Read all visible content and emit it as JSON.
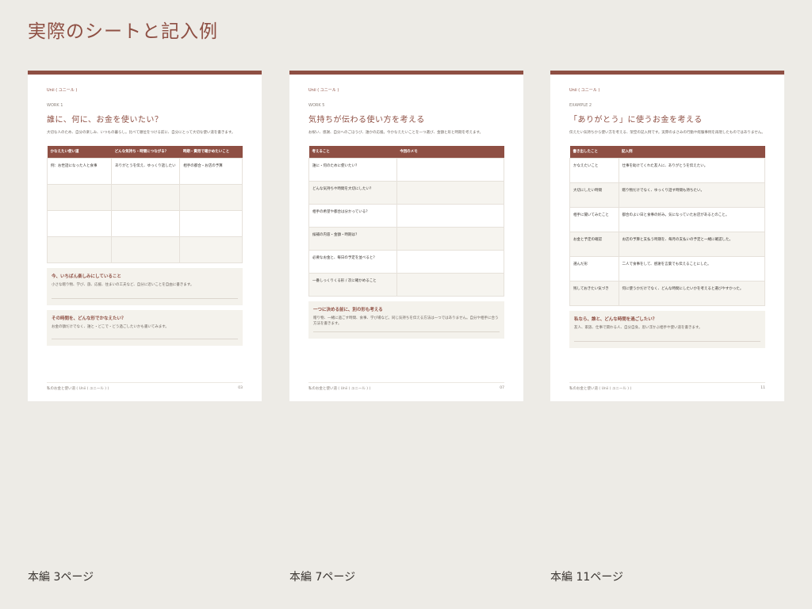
{
  "heading": "実際のシートと記入例",
  "sheets": [
    {
      "logo": "Unii ( ユニール )",
      "kicker": "WORK 1",
      "title": "誰に、何に、お金を使いたい？",
      "desc": "大切な人のため、自分の楽しみ、いつもの暮らし。比べて順位をつける前に、自分にとって大切な使い道を書きます。",
      "headers": [
        "かなえたい使い道",
        "どんな気持ち・時間につながる？",
        "時期・費用で確かめたいこと"
      ],
      "rows": [
        [
          "例：お世話になった人と食事",
          "ありがとうを伝え、ゆっくり話したい",
          "相手の都合・お店の予算"
        ],
        [
          "",
          "",
          ""
        ],
        [
          "",
          "",
          ""
        ],
        [
          "",
          "",
          ""
        ]
      ],
      "notes": [
        {
          "title": "今、いちばん楽しみにしていること",
          "text": "小さな贈り物、学び、旅、応援、住まいの工夫など、自分に近いことを自由に書きます。"
        },
        {
          "title": "その時間を、どんな形でかなえたい？",
          "text": "お金の額だけでなく、誰と・どこで・どう過ごしたいかも書いてみます。"
        }
      ],
      "footer_left": "私のお金と使い道 ( Unii ( ユニール ) )",
      "footer_right": "03",
      "caption": "本編 3ページ"
    },
    {
      "logo": "Unii ( ユニール )",
      "kicker": "WORK 5",
      "title": "気持ちが伝わる使い方を考える",
      "desc": "お祝い、感謝、自分へのごほうび、誰かの応援。今かなえたいことを一つ選び、金額と形と時期を考えます。",
      "headers": [
        "考えること",
        "今回のメモ"
      ],
      "rows": [
        [
          "誰に・何のために使いたい？",
          ""
        ],
        [
          "どんな気持ちや時間を大切にしたい？",
          ""
        ],
        [
          "相手の希望や都合は分かっている？",
          ""
        ],
        [
          "候補の内容・金額・時期は？",
          ""
        ],
        [
          "必要なお金と、毎日の予定を並べると？",
          ""
        ],
        [
          "一番しっくりくる形 / 次に確かめること",
          ""
        ]
      ],
      "notes": [
        {
          "title": "一つに決める前に、別の形も考える",
          "text": "贈り物、一緒に過ごす時間、食事、学び場など。同じ気持ちを伝える方法は一つではありません。自分や相手に合う方法を書きます。"
        }
      ],
      "footer_left": "私のお金と使い道 ( Unii ( ユニール ) )",
      "footer_right": "07",
      "caption": "本編 7ページ"
    },
    {
      "logo": "Unii ( ユニール )",
      "kicker": "EXAMPLE 2",
      "title": "「ありがとう」に使うお金を考える",
      "desc": "伝えたい気持ちから使い方を考える、架空の記入例です。実際のまさみの行動や経験事例を再現したものではありません。",
      "headers": [
        "書き出したこと",
        "記入例"
      ],
      "rows": [
        [
          "かなえたいこと",
          "仕事を助けてくれた友人に、ありがとうを伝えたい。"
        ],
        [
          "大切にしたい時間",
          "贈り物だけでなく、ゆっくり話す時間も持ちたい。"
        ],
        [
          "相手に聞いてみたこと",
          "都合のよい日と食事の好み。気になっていたお店があるとのこと。"
        ],
        [
          "お金と予定の確認",
          "お店の予算と支払う時期を、毎月の支払いの予定と一緒に確認した。"
        ],
        [
          "選んだ形",
          "二人で食事をして、感謝を言葉でも伝えることにした。"
        ],
        [
          "残しておきたい気づき",
          "何に使うかだけでなく、どんな時間にしたいかを考えると選びやすかった。"
        ]
      ],
      "notes": [
        {
          "title": "私なら、誰と、どんな時間を過ごしたい？",
          "text": "友人、家族、仕事で関わる人、自分自身。思い浮かぶ相手や使い道を書きます。"
        }
      ],
      "footer_left": "私のお金と使い道 ( Unii ( ユニール ) )",
      "footer_right": "11",
      "caption": "本編 11ページ"
    }
  ],
  "colors": {
    "accent": "#8e4f43",
    "background": "#edebe6",
    "note_bg": "#f4f2ec"
  }
}
